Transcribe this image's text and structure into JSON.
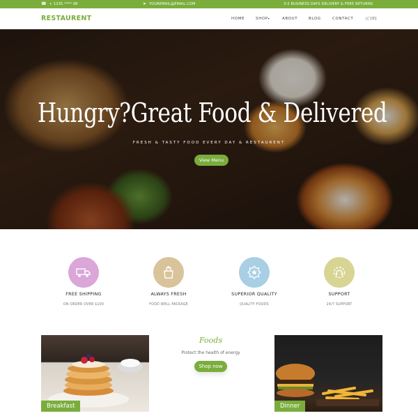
{
  "topbar": {
    "phone": "+ 1235 **** 98",
    "email": "YOUREMAIL@EMAIL.COM",
    "notice": "3-5 BUSINESS DAYS DELIVERY & FREE RETURNS"
  },
  "nav": {
    "brand": "RESTAURENT",
    "items": [
      "HOME",
      "SHOP",
      "ABOUT",
      "BLOG",
      "CONTACT"
    ],
    "cart": "[0]"
  },
  "hero": {
    "title": "Hungry?Great Food & Delivered",
    "subtitle": "FRESH & TASTY FOOD EVERY DAY & RESTAURENT",
    "button": "View Menu"
  },
  "features": [
    {
      "title": "FREE SHIPPING",
      "desc": "ON ORDER OVER $100",
      "icon": "truck-icon",
      "color": "#dba6d8"
    },
    {
      "title": "ALWAYS FRESH",
      "desc": "FOOD WELL PACKAGE",
      "icon": "grocery-bag-icon",
      "color": "#d9c39a"
    },
    {
      "title": "SUPERIOR QUALITY",
      "desc": "QUALITY FOODS",
      "icon": "award-badge-icon",
      "color": "#a8cfe3"
    },
    {
      "title": "SUPPORT",
      "desc": "24/7 SUPPORT",
      "icon": "support-headset-icon",
      "color": "#d8d494"
    }
  ],
  "foods": {
    "heading": "Foods",
    "text": "Protect the health of energy",
    "button": "Shop now",
    "left_tag": "Breakfast",
    "right_tag": "Dinner"
  },
  "colors": {
    "accent": "#7aad3c"
  }
}
